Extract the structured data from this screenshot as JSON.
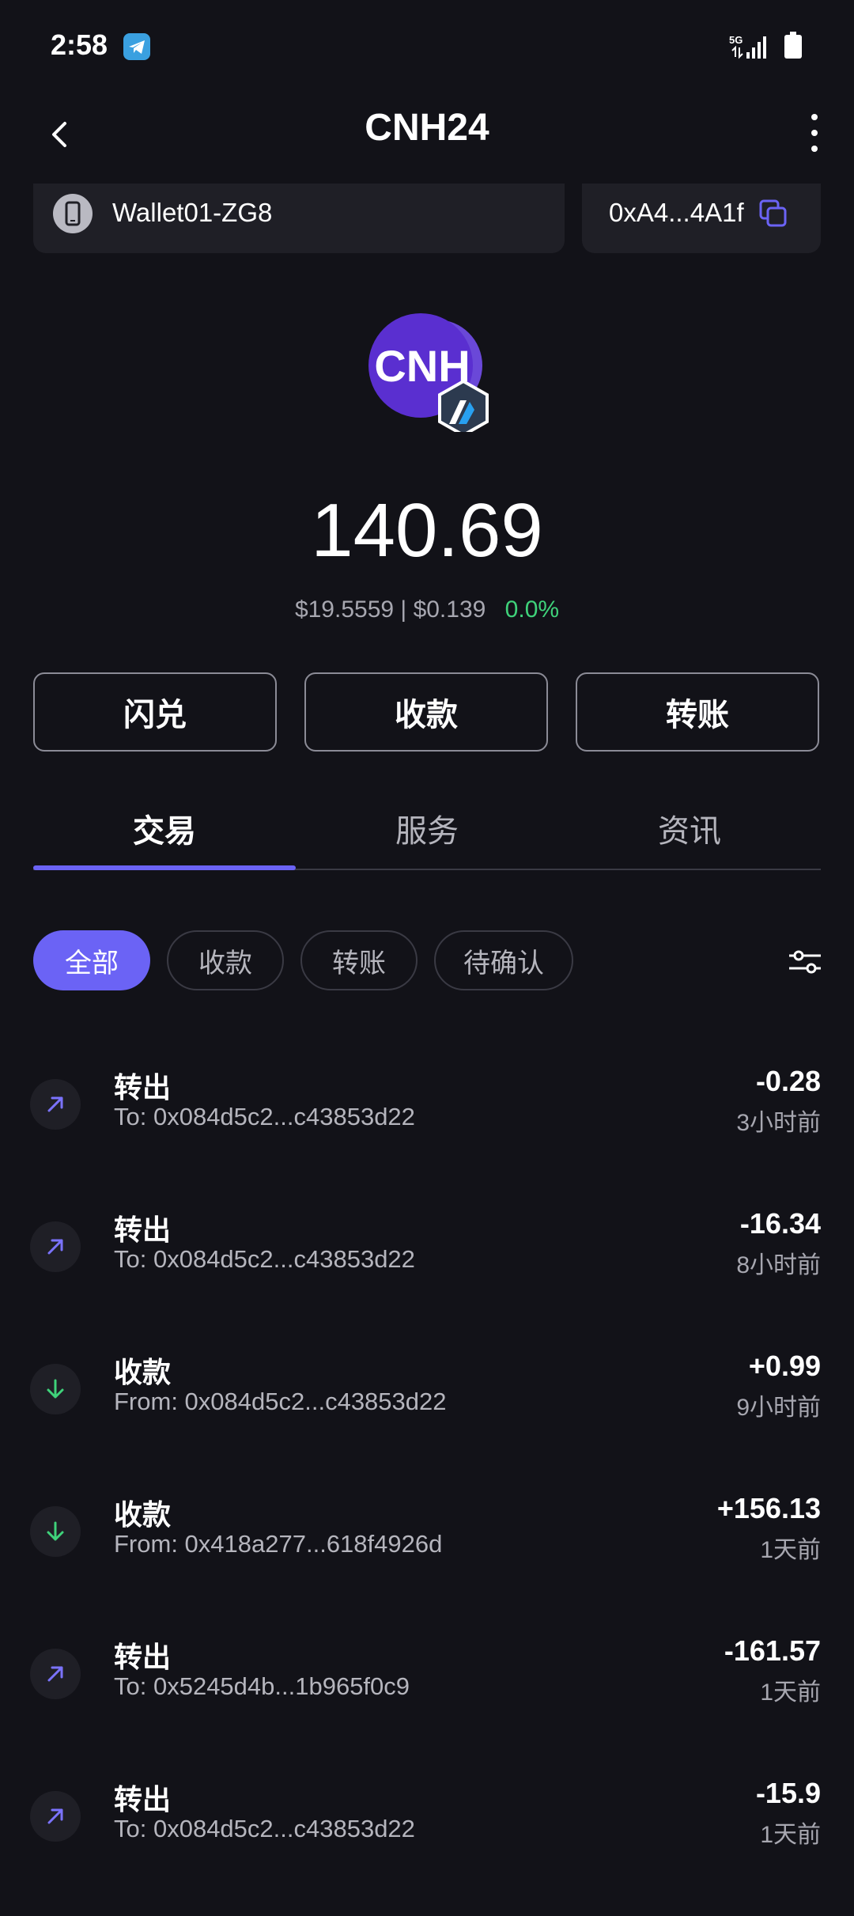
{
  "status_bar": {
    "time": "2:58",
    "network": "5G",
    "icons": [
      "telegram-icon",
      "signal-icon",
      "battery-icon"
    ]
  },
  "header": {
    "title": "CNH24",
    "back_icon": "chevron-left-icon",
    "more_icon": "more-vertical-icon"
  },
  "wallet": {
    "name": "Wallet01-ZG8",
    "address": "0xA4...4A1f",
    "device_icon": "phone-icon",
    "copy_icon": "copy-icon"
  },
  "token": {
    "logo_text": "CNH",
    "balance": "140.69",
    "value": "$19.5559",
    "separator": "|",
    "price": "$0.139",
    "change": "0.0%"
  },
  "actions": {
    "swap": "闪兑",
    "receive": "收款",
    "send": "转账"
  },
  "tabs": [
    "交易",
    "服务",
    "资讯"
  ],
  "filters": [
    "全部",
    "收款",
    "转账",
    "待确认"
  ],
  "transactions": [
    {
      "type": "转出",
      "address": "To: 0x084d5c2...c43853d22",
      "amount": "-0.28",
      "time": "3小时前",
      "direction": "out"
    },
    {
      "type": "转出",
      "address": "To: 0x084d5c2...c43853d22",
      "amount": "-16.34",
      "time": "8小时前",
      "direction": "out"
    },
    {
      "type": "收款",
      "address": "From: 0x084d5c2...c43853d22",
      "amount": "+0.99",
      "time": "9小时前",
      "direction": "in"
    },
    {
      "type": "收款",
      "address": "From: 0x418a277...618f4926d",
      "amount": "+156.13",
      "time": "1天前",
      "direction": "in"
    },
    {
      "type": "转出",
      "address": "To: 0x5245d4b...1b965f0c9",
      "amount": "-161.57",
      "time": "1天前",
      "direction": "out"
    },
    {
      "type": "转出",
      "address": "To: 0x084d5c2...c43853d22",
      "amount": "-15.9",
      "time": "1天前",
      "direction": "out"
    }
  ],
  "colors": {
    "background": "#121218",
    "accent": "#6b63f5",
    "positive": "#3fd27a",
    "card": "#1f1f26"
  }
}
